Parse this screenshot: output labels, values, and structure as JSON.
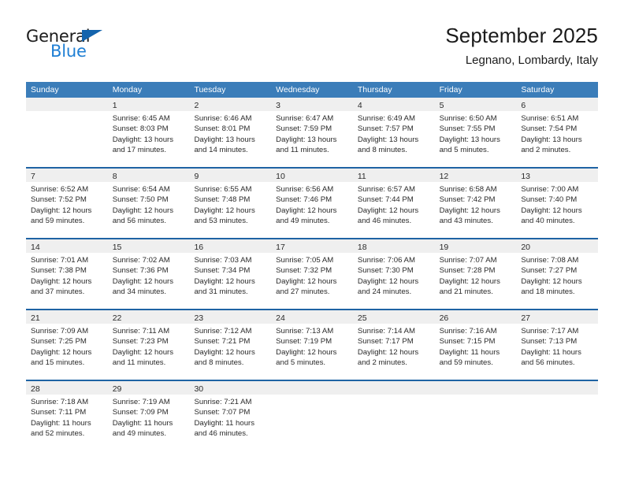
{
  "brand": {
    "word_one": "General",
    "word_two": "Blue",
    "triangle_color": "#1464ad",
    "blue_color": "#1f7fd4"
  },
  "header": {
    "title": "September 2025",
    "subtitle": "Legnano, Lombardy, Italy"
  },
  "theme": {
    "header_blue": "#3b7db9",
    "divider_blue": "#1f63a4",
    "day_band_gray": "#efefef",
    "text": "#2a2a2a"
  },
  "weekdays": [
    "Sunday",
    "Monday",
    "Tuesday",
    "Wednesday",
    "Thursday",
    "Friday",
    "Saturday"
  ],
  "weeks": [
    [
      {
        "empty": true
      },
      {
        "day": "1",
        "sunrise": "Sunrise: 6:45 AM",
        "sunset": "Sunset: 8:03 PM",
        "daylight_1": "Daylight: 13 hours",
        "daylight_2": "and 17 minutes."
      },
      {
        "day": "2",
        "sunrise": "Sunrise: 6:46 AM",
        "sunset": "Sunset: 8:01 PM",
        "daylight_1": "Daylight: 13 hours",
        "daylight_2": "and 14 minutes."
      },
      {
        "day": "3",
        "sunrise": "Sunrise: 6:47 AM",
        "sunset": "Sunset: 7:59 PM",
        "daylight_1": "Daylight: 13 hours",
        "daylight_2": "and 11 minutes."
      },
      {
        "day": "4",
        "sunrise": "Sunrise: 6:49 AM",
        "sunset": "Sunset: 7:57 PM",
        "daylight_1": "Daylight: 13 hours",
        "daylight_2": "and 8 minutes."
      },
      {
        "day": "5",
        "sunrise": "Sunrise: 6:50 AM",
        "sunset": "Sunset: 7:55 PM",
        "daylight_1": "Daylight: 13 hours",
        "daylight_2": "and 5 minutes."
      },
      {
        "day": "6",
        "sunrise": "Sunrise: 6:51 AM",
        "sunset": "Sunset: 7:54 PM",
        "daylight_1": "Daylight: 13 hours",
        "daylight_2": "and 2 minutes."
      }
    ],
    [
      {
        "day": "7",
        "sunrise": "Sunrise: 6:52 AM",
        "sunset": "Sunset: 7:52 PM",
        "daylight_1": "Daylight: 12 hours",
        "daylight_2": "and 59 minutes."
      },
      {
        "day": "8",
        "sunrise": "Sunrise: 6:54 AM",
        "sunset": "Sunset: 7:50 PM",
        "daylight_1": "Daylight: 12 hours",
        "daylight_2": "and 56 minutes."
      },
      {
        "day": "9",
        "sunrise": "Sunrise: 6:55 AM",
        "sunset": "Sunset: 7:48 PM",
        "daylight_1": "Daylight: 12 hours",
        "daylight_2": "and 53 minutes."
      },
      {
        "day": "10",
        "sunrise": "Sunrise: 6:56 AM",
        "sunset": "Sunset: 7:46 PM",
        "daylight_1": "Daylight: 12 hours",
        "daylight_2": "and 49 minutes."
      },
      {
        "day": "11",
        "sunrise": "Sunrise: 6:57 AM",
        "sunset": "Sunset: 7:44 PM",
        "daylight_1": "Daylight: 12 hours",
        "daylight_2": "and 46 minutes."
      },
      {
        "day": "12",
        "sunrise": "Sunrise: 6:58 AM",
        "sunset": "Sunset: 7:42 PM",
        "daylight_1": "Daylight: 12 hours",
        "daylight_2": "and 43 minutes."
      },
      {
        "day": "13",
        "sunrise": "Sunrise: 7:00 AM",
        "sunset": "Sunset: 7:40 PM",
        "daylight_1": "Daylight: 12 hours",
        "daylight_2": "and 40 minutes."
      }
    ],
    [
      {
        "day": "14",
        "sunrise": "Sunrise: 7:01 AM",
        "sunset": "Sunset: 7:38 PM",
        "daylight_1": "Daylight: 12 hours",
        "daylight_2": "and 37 minutes."
      },
      {
        "day": "15",
        "sunrise": "Sunrise: 7:02 AM",
        "sunset": "Sunset: 7:36 PM",
        "daylight_1": "Daylight: 12 hours",
        "daylight_2": "and 34 minutes."
      },
      {
        "day": "16",
        "sunrise": "Sunrise: 7:03 AM",
        "sunset": "Sunset: 7:34 PM",
        "daylight_1": "Daylight: 12 hours",
        "daylight_2": "and 31 minutes."
      },
      {
        "day": "17",
        "sunrise": "Sunrise: 7:05 AM",
        "sunset": "Sunset: 7:32 PM",
        "daylight_1": "Daylight: 12 hours",
        "daylight_2": "and 27 minutes."
      },
      {
        "day": "18",
        "sunrise": "Sunrise: 7:06 AM",
        "sunset": "Sunset: 7:30 PM",
        "daylight_1": "Daylight: 12 hours",
        "daylight_2": "and 24 minutes."
      },
      {
        "day": "19",
        "sunrise": "Sunrise: 7:07 AM",
        "sunset": "Sunset: 7:28 PM",
        "daylight_1": "Daylight: 12 hours",
        "daylight_2": "and 21 minutes."
      },
      {
        "day": "20",
        "sunrise": "Sunrise: 7:08 AM",
        "sunset": "Sunset: 7:27 PM",
        "daylight_1": "Daylight: 12 hours",
        "daylight_2": "and 18 minutes."
      }
    ],
    [
      {
        "day": "21",
        "sunrise": "Sunrise: 7:09 AM",
        "sunset": "Sunset: 7:25 PM",
        "daylight_1": "Daylight: 12 hours",
        "daylight_2": "and 15 minutes."
      },
      {
        "day": "22",
        "sunrise": "Sunrise: 7:11 AM",
        "sunset": "Sunset: 7:23 PM",
        "daylight_1": "Daylight: 12 hours",
        "daylight_2": "and 11 minutes."
      },
      {
        "day": "23",
        "sunrise": "Sunrise: 7:12 AM",
        "sunset": "Sunset: 7:21 PM",
        "daylight_1": "Daylight: 12 hours",
        "daylight_2": "and 8 minutes."
      },
      {
        "day": "24",
        "sunrise": "Sunrise: 7:13 AM",
        "sunset": "Sunset: 7:19 PM",
        "daylight_1": "Daylight: 12 hours",
        "daylight_2": "and 5 minutes."
      },
      {
        "day": "25",
        "sunrise": "Sunrise: 7:14 AM",
        "sunset": "Sunset: 7:17 PM",
        "daylight_1": "Daylight: 12 hours",
        "daylight_2": "and 2 minutes."
      },
      {
        "day": "26",
        "sunrise": "Sunrise: 7:16 AM",
        "sunset": "Sunset: 7:15 PM",
        "daylight_1": "Daylight: 11 hours",
        "daylight_2": "and 59 minutes."
      },
      {
        "day": "27",
        "sunrise": "Sunrise: 7:17 AM",
        "sunset": "Sunset: 7:13 PM",
        "daylight_1": "Daylight: 11 hours",
        "daylight_2": "and 56 minutes."
      }
    ],
    [
      {
        "day": "28",
        "sunrise": "Sunrise: 7:18 AM",
        "sunset": "Sunset: 7:11 PM",
        "daylight_1": "Daylight: 11 hours",
        "daylight_2": "and 52 minutes."
      },
      {
        "day": "29",
        "sunrise": "Sunrise: 7:19 AM",
        "sunset": "Sunset: 7:09 PM",
        "daylight_1": "Daylight: 11 hours",
        "daylight_2": "and 49 minutes."
      },
      {
        "day": "30",
        "sunrise": "Sunrise: 7:21 AM",
        "sunset": "Sunset: 7:07 PM",
        "daylight_1": "Daylight: 11 hours",
        "daylight_2": "and 46 minutes."
      },
      {
        "empty": true
      },
      {
        "empty": true
      },
      {
        "empty": true
      },
      {
        "empty": true
      }
    ]
  ]
}
